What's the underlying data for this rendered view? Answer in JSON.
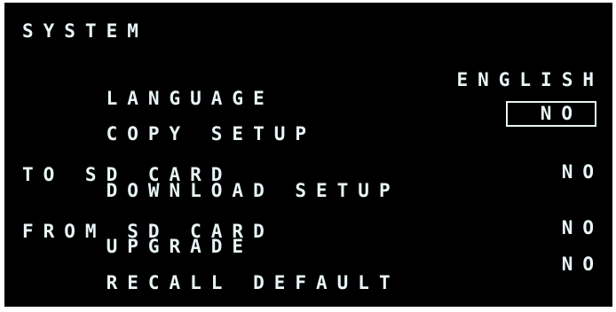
{
  "menu": {
    "title": "SYSTEM",
    "selected_index": 1,
    "items": [
      {
        "label_lines": [
          "LANGUAGE"
        ],
        "value": "ENGLISH"
      },
      {
        "label_lines": [
          "COPY SETUP",
          "TO SD CARD"
        ],
        "value": "NO"
      },
      {
        "label_lines": [
          "DOWNLOAD SETUP",
          "FROM SD CARD"
        ],
        "value": "NO"
      },
      {
        "label_lines": [
          "UPGRADE"
        ],
        "value": "NO"
      },
      {
        "label_lines": [
          "RECALL DEFAULT"
        ],
        "value": "NO"
      }
    ]
  },
  "colors": {
    "background": "#000000",
    "text": "#e9f4f6",
    "frame": "#ffffff"
  }
}
